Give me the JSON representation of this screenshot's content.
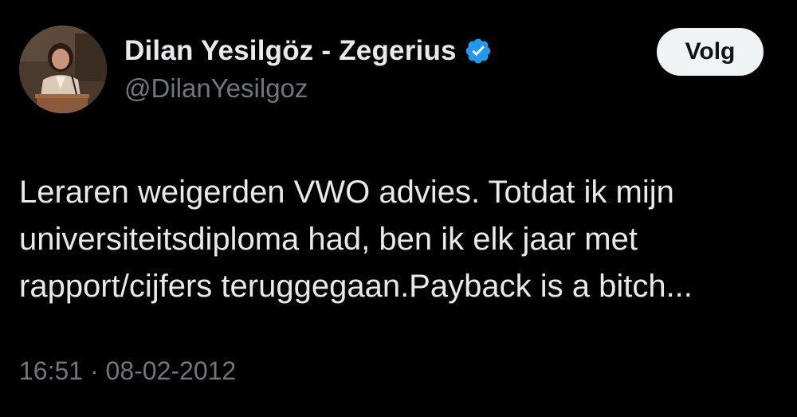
{
  "author": {
    "display_name": "Dilan Yesilgöz - Zegerius",
    "handle": "@DilanYesilgoz",
    "verified_icon": "verified-badge-icon",
    "verified_color": "#1d9bf0"
  },
  "follow_button": {
    "label": "Volg"
  },
  "tweet": {
    "text": "Leraren weigerden VWO advies. Totdat ik mijn\nuniversiteitsdiploma had, ben ik elk jaar met\nrapport/cijfers teruggegaan.Payback is a bitch..."
  },
  "meta": {
    "time": "16:51",
    "separator": " · ",
    "date": "08-02-2012"
  },
  "colors": {
    "background": "#000000",
    "text_primary": "#e7e9ea",
    "text_secondary": "#71767b",
    "button_bg": "#eff3f4",
    "button_text": "#0f1419"
  }
}
